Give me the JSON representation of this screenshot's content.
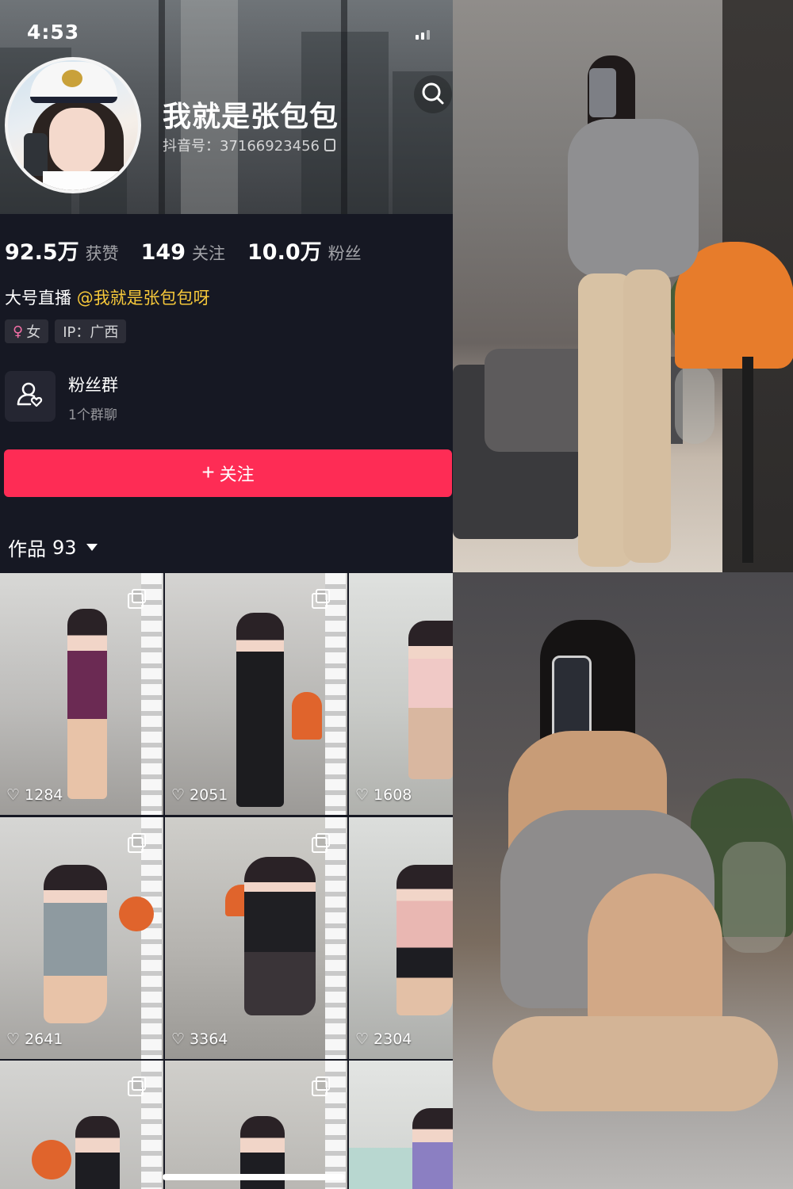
{
  "status_bar": {
    "time": "4:53"
  },
  "profile": {
    "name": "我就是张包包",
    "douyin_id": "抖音号：37166923456",
    "stats": [
      {
        "num": "92.5万",
        "label": "获赞"
      },
      {
        "num": "149",
        "label": "关注"
      },
      {
        "num": "10.0万",
        "label": "粉丝"
      }
    ],
    "bio_prefix": "大号直播",
    "bio_mention": "@我就是张包包呀",
    "tags": {
      "gender": "女",
      "ip": "IP：广西"
    },
    "fans_group": {
      "title": "粉丝群",
      "subtitle": "1个群聊"
    },
    "follow_button": "关注"
  },
  "works": {
    "tab_label": "作品",
    "count": "93",
    "videos": [
      {
        "likes": "1284"
      },
      {
        "likes": "2051"
      },
      {
        "likes": "1608"
      },
      {
        "likes": "2641"
      },
      {
        "likes": "3364"
      },
      {
        "likes": "2304"
      },
      {
        "likes": ""
      },
      {
        "likes": ""
      },
      {
        "likes": ""
      }
    ]
  },
  "colors": {
    "background": "#161823",
    "follow_button": "#fe2c55",
    "mention": "#f6c83a",
    "gender_icon": "#f36fa6"
  },
  "icons": {
    "back": "chevron-left-icon",
    "search": "search-icon",
    "copy": "copy-icon",
    "fans_group": "fans-group-icon",
    "like": "heart-icon",
    "multi_image": "multi-image-icon"
  }
}
